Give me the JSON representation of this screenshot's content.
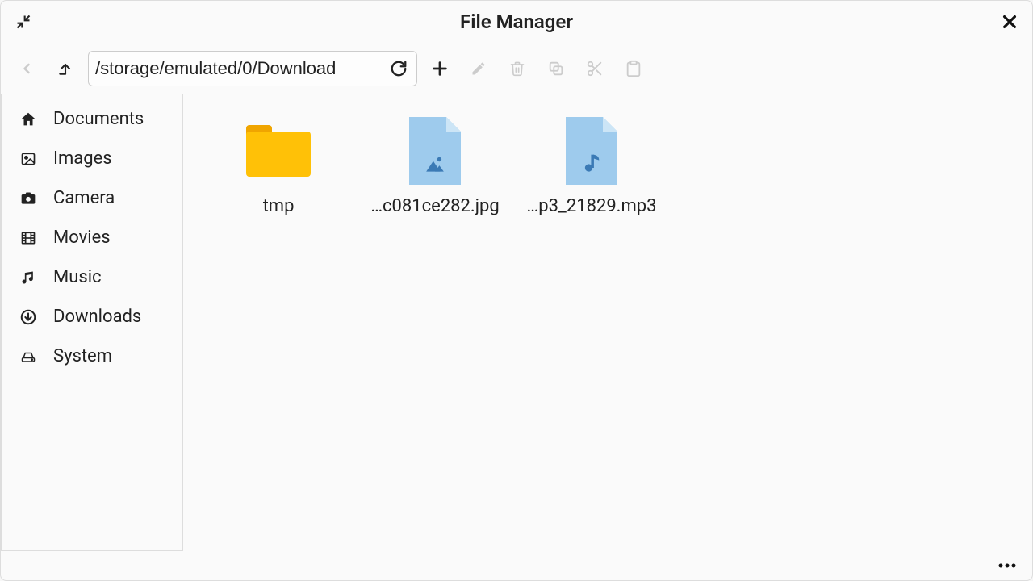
{
  "window": {
    "title": "File Manager"
  },
  "toolbar": {
    "path": "/storage/emulated/0/Download"
  },
  "sidebar": {
    "items": [
      {
        "icon": "home",
        "label": "Documents"
      },
      {
        "icon": "image",
        "label": "Images"
      },
      {
        "icon": "camera",
        "label": "Camera"
      },
      {
        "icon": "film",
        "label": "Movies"
      },
      {
        "icon": "music",
        "label": "Music"
      },
      {
        "icon": "download",
        "label": "Downloads"
      },
      {
        "icon": "hdd",
        "label": "System"
      }
    ]
  },
  "files": [
    {
      "type": "folder",
      "label": "tmp"
    },
    {
      "type": "image",
      "label": "…c081ce282.jpg"
    },
    {
      "type": "audio",
      "label": "…p3_21829.mp3"
    }
  ]
}
